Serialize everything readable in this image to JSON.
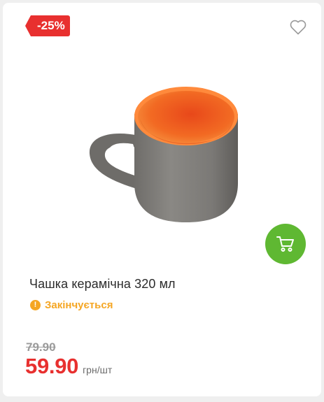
{
  "product": {
    "discount_badge": "-25%",
    "title": "Чашка керамічна 320 мл",
    "status": "Закінчується",
    "old_price": "79.90",
    "price": "59.90",
    "unit": "грн/шт"
  },
  "icons": {
    "favorite": "heart-outline-icon",
    "cart": "shopping-cart-icon",
    "status": "exclamation-circle-icon"
  },
  "colors": {
    "discount": "#e8302f",
    "price": "#e8302f",
    "cart_button": "#5fb832",
    "status": "#f5a623"
  }
}
